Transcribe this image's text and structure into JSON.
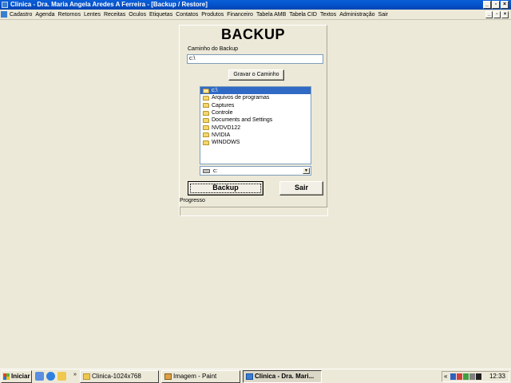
{
  "window": {
    "title": "Clinica - Dra. Maria Angela Aredes A Ferreira - [Backup / Restore]",
    "controls": {
      "minimize": "_",
      "maximize": "▫",
      "close": "×"
    }
  },
  "menu": {
    "items": [
      "Cadastro",
      "Agenda",
      "Retornos",
      "Lentes",
      "Receitas",
      "Oculos",
      "Etiquetas",
      "Contatos",
      "Produtos",
      "Financeiro",
      "Tabela AMB",
      "Tabela CID",
      "Textos",
      "Administração",
      "Sair"
    ]
  },
  "form": {
    "heading": "BACKUP",
    "path_label": "Caminho do Backup",
    "path_value": "c:\\",
    "save_path_button": "Gravar o Caminho",
    "folders": [
      {
        "name": "c:\\",
        "selected": true
      },
      {
        "name": "Arquivos de programas",
        "selected": false
      },
      {
        "name": "Captures",
        "selected": false
      },
      {
        "name": "Controle",
        "selected": false
      },
      {
        "name": "Documents and Settings",
        "selected": false
      },
      {
        "name": "NVDVD122",
        "selected": false
      },
      {
        "name": "NVIDIA",
        "selected": false
      },
      {
        "name": "WINDOWS",
        "selected": false
      }
    ],
    "drive_value": "c:",
    "backup_button": "Backup",
    "exit_button": "Sair",
    "progress_label": "Progresso",
    "progress_value": 0
  },
  "taskbar": {
    "start_label": "Iniciar",
    "quick_launch": [
      "desktop-icon",
      "ie-icon",
      "folder-icon"
    ],
    "chevron": "»",
    "tasks": [
      {
        "label": "Clinica-1024x768",
        "icon": "folder-icon",
        "active": false
      },
      {
        "label": "Imagem - Paint",
        "icon": "paint-icon",
        "active": false
      },
      {
        "label": "Clinica - Dra. Mari...",
        "icon": "app-icon",
        "active": true
      }
    ],
    "tray_chevron": "«",
    "clock": "12:33"
  },
  "colors": {
    "title_bar": "#0450c8",
    "selection": "#316ac5",
    "face": "#ece9d8"
  }
}
